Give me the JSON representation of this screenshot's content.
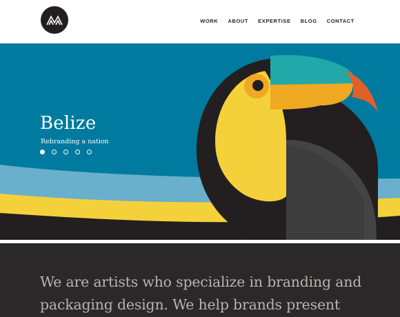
{
  "header": {
    "logo_icon": "mountain-m-logo-icon",
    "nav": [
      {
        "label": "WORK"
      },
      {
        "label": "ABOUT"
      },
      {
        "label": "EXPERTISE"
      },
      {
        "label": "BLOG"
      },
      {
        "label": "CONTACT"
      }
    ]
  },
  "hero": {
    "title": "Belize",
    "subtitle": "Rebranding a nation",
    "slides_total": 5,
    "active_slide": 1,
    "illustration": "toucan-illustration",
    "colors": {
      "sky": "#007a9e",
      "band": "#6aafcc",
      "yellow": "#f4d13b",
      "dark": "#231f20",
      "beak_teal": "#21a8a8",
      "beak_orange": "#f0a922",
      "beak_tip": "#e1602a",
      "wing": "#444444"
    }
  },
  "intro": {
    "text": "We are artists who specialize in branding and packaging design. We help brands present"
  }
}
